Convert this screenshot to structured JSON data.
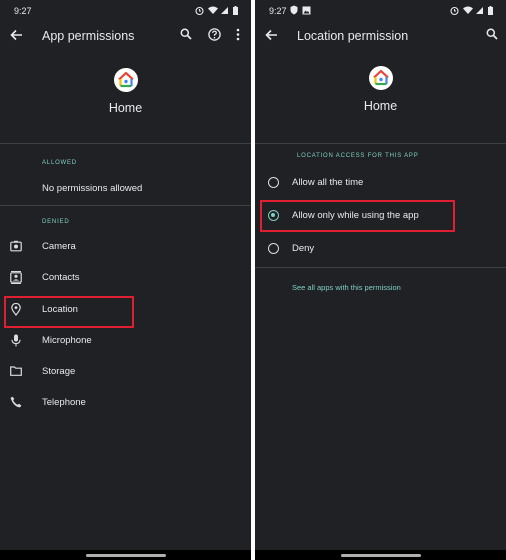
{
  "left": {
    "status_time": "9:27",
    "title": "App permissions",
    "app_name": "Home",
    "allowed_header": "ALLOWED",
    "allowed_empty": "No permissions allowed",
    "denied_header": "DENIED",
    "denied_items": [
      {
        "label": "Camera",
        "icon": "camera-icon"
      },
      {
        "label": "Contacts",
        "icon": "contacts-icon"
      },
      {
        "label": "Location",
        "icon": "location-pin-icon"
      },
      {
        "label": "Microphone",
        "icon": "microphone-icon"
      },
      {
        "label": "Storage",
        "icon": "folder-icon"
      },
      {
        "label": "Telephone",
        "icon": "phone-icon"
      }
    ]
  },
  "right": {
    "status_time": "9:27",
    "title": "Location permission",
    "app_name": "Home",
    "section_header": "LOCATION ACCESS FOR THIS APP",
    "options": [
      {
        "label": "Allow all the time",
        "selected": false
      },
      {
        "label": "Allow only while using the app",
        "selected": true
      },
      {
        "label": "Deny",
        "selected": false
      }
    ],
    "link": "See all apps with this permission"
  },
  "colors": {
    "background": "#202124",
    "accent": "#7fcfc4",
    "highlight": "#e02030",
    "text": "#e8eaed"
  }
}
